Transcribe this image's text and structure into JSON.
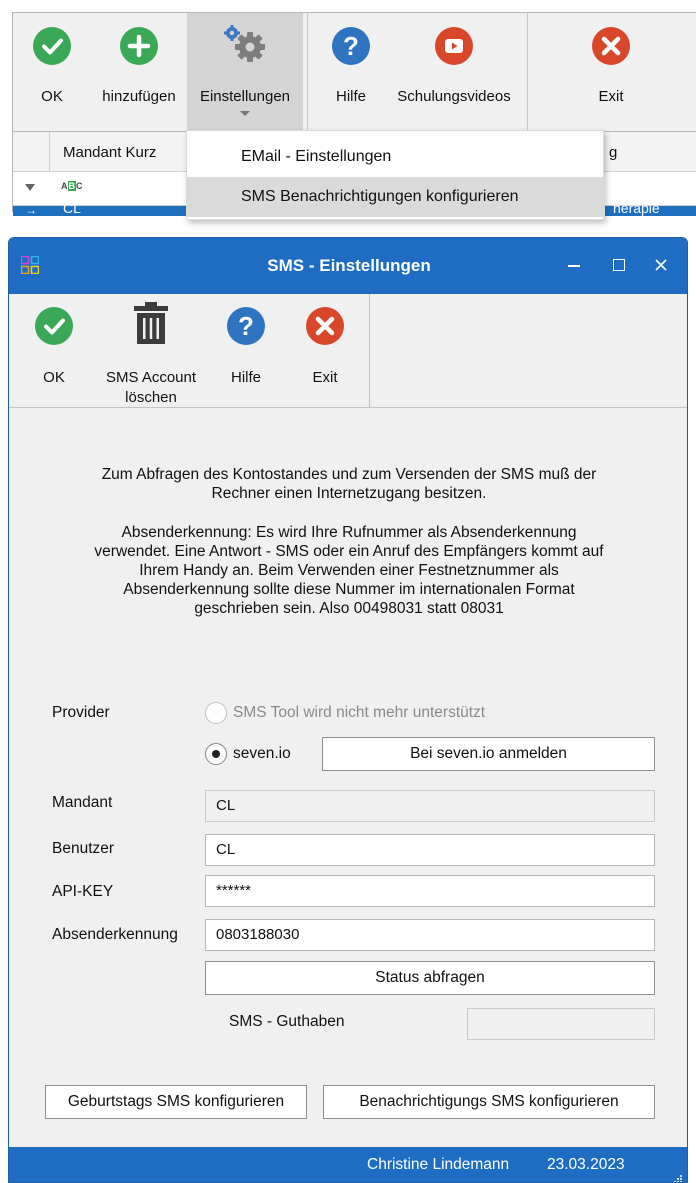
{
  "main_toolbar": {
    "ok_label": "OK",
    "add_label": "hinzufügen",
    "settings_label": "Einstellungen",
    "help_label": "Hilfe",
    "videos_label": "Schulungsvideos",
    "exit_label": "Exit"
  },
  "grid": {
    "column_header": "Mandant Kurz",
    "right_header_partial": "g",
    "row_value_partial": "CL",
    "row_right_partial": "herapie"
  },
  "dropdown": {
    "items": [
      {
        "label": "EMail - Einstellungen"
      },
      {
        "label": "SMS Benachrichtigungen konfigurieren"
      }
    ]
  },
  "dialog": {
    "title": "SMS - Einstellungen",
    "toolbar": {
      "ok_label": "OK",
      "delete_label_1": "SMS Account",
      "delete_label_2": "löschen",
      "help_label": "Hilfe",
      "exit_label": "Exit"
    },
    "info": {
      "p1_l1": "Zum Abfragen des Kontostandes und zum Versenden der SMS muß der",
      "p1_l2": "Rechner einen Internetzugang besitzen.",
      "p2_l1": "Absenderkennung: Es wird Ihre Rufnummer als Absenderkennung",
      "p2_l2": "verwendet. Eine Antwort - SMS oder ein Anruf des Empfängers kommt auf",
      "p2_l3": "Ihrem Handy an. Beim Verwenden einer Festnetznummer  als",
      "p2_l4": "Absenderkennung sollte diese Nummer im internationalen Format",
      "p2_l5": "geschrieben sein.  Also 00498031 statt 08031"
    },
    "form": {
      "provider_label": "Provider",
      "provider_option_1": "SMS Tool wird nicht mehr unterstützt",
      "provider_option_2": "seven.io",
      "register_button": "Bei seven.io anmelden",
      "mandant_label": "Mandant",
      "mandant_value": "CL",
      "benutzer_label": "Benutzer",
      "benutzer_value": "CL",
      "apikey_label": "API-KEY",
      "apikey_value": "******",
      "sender_label": "Absenderkennung",
      "sender_value": "0803188030",
      "status_button": "Status abfragen",
      "credit_label": "SMS - Guthaben",
      "credit_value": ""
    },
    "bottom_buttons": {
      "birthday": "Geburtstags SMS konfigurieren",
      "notification": "Benachrichtigungs  SMS konfigurieren"
    },
    "statusbar": {
      "user": "Christine Lindemann",
      "date": "23.03.2023"
    }
  }
}
